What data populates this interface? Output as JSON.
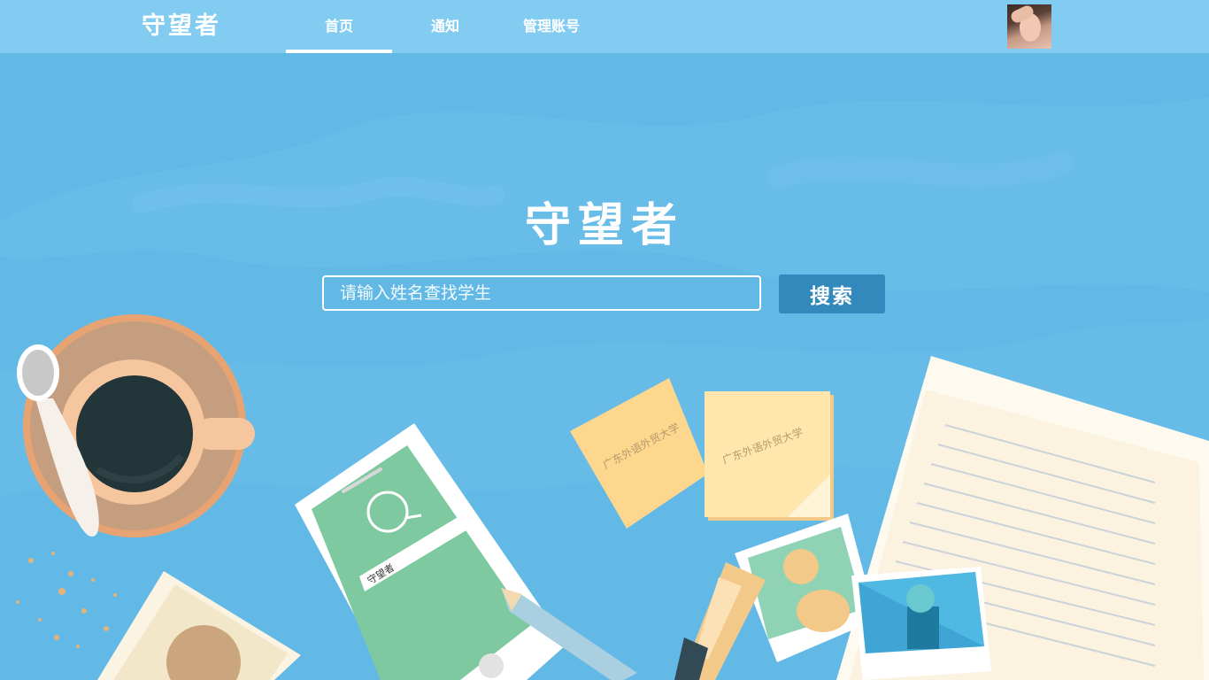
{
  "header": {
    "logo": "守望者",
    "nav": [
      {
        "label": "首页",
        "active": true
      },
      {
        "label": "通知",
        "active": false
      },
      {
        "label": "管理账号",
        "active": false
      }
    ]
  },
  "hero": {
    "title": "守望者",
    "search_placeholder": "请输入姓名查找学生",
    "search_button": "搜索"
  },
  "illustration": {
    "phone_search_text": "守望者",
    "note_text_1": "广东外语外贸大学",
    "note_text_2": "广东外语外贸大学"
  },
  "colors": {
    "background": "#62b9e6",
    "topbar": "#82cbf1",
    "button": "#3389bb"
  }
}
